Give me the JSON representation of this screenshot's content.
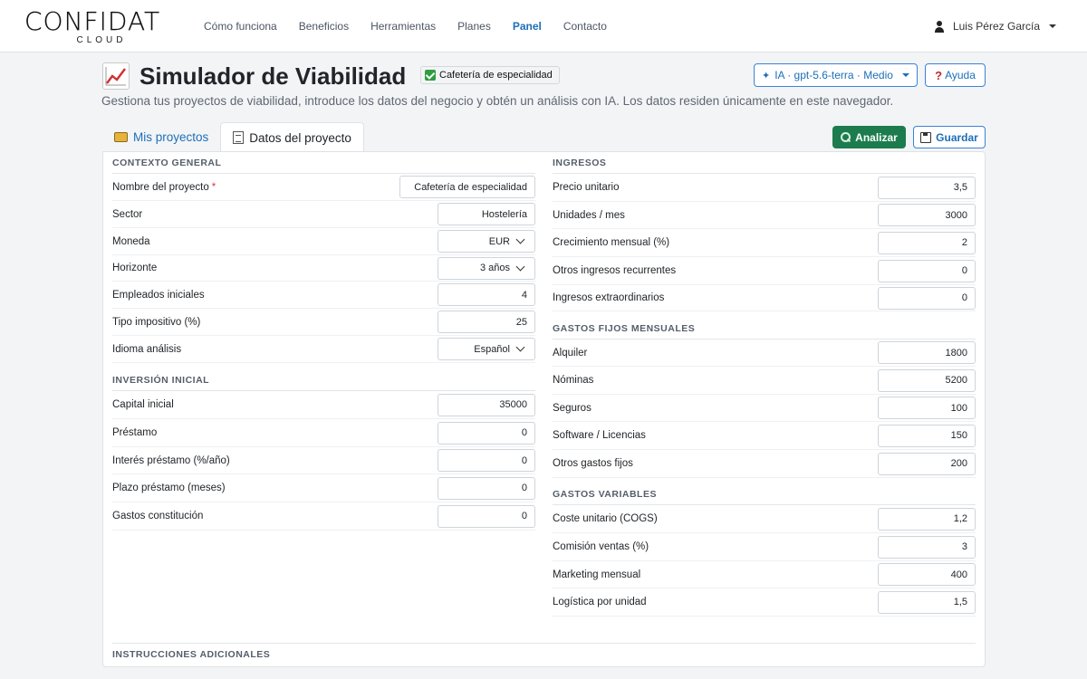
{
  "brand": {
    "name": "CONFIDAT",
    "sub": "CLOUD"
  },
  "nav": {
    "items": [
      "Cómo funciona",
      "Beneficios",
      "Herramientas",
      "Planes",
      "Panel",
      "Contacto"
    ],
    "active": "Panel"
  },
  "user": {
    "name": "Luis Pérez García"
  },
  "header": {
    "title_icon": "chart-increasing-icon",
    "title": "Simulador de Viabilidad",
    "project_badge": "Cafetería de especialidad",
    "ai_label": "IA · gpt-5.6-terra · Medio",
    "help_label": "Ayuda",
    "subtitle": "Gestiona tus proyectos de viabilidad, introduce los datos del negocio y obtén un análisis con IA. Los datos residen únicamente en este navegador."
  },
  "tabs": [
    {
      "label": "Mis proyectos",
      "icon": "folder-icon"
    },
    {
      "label": "Datos del proyecto",
      "icon": "memo-icon",
      "active": true
    }
  ],
  "actions": {
    "analyze": "Analizar",
    "save": "Guardar"
  },
  "sections": {
    "contexto": "CONTEXTO GENERAL",
    "inversion": "INVERSIÓN INICIAL",
    "ingresos": "INGRESOS",
    "fijos": "GASTOS FIJOS MENSUALES",
    "variables": "GASTOS VARIABLES",
    "instrucciones": "INSTRUCCIONES ADICIONALES"
  },
  "contexto": {
    "nombre": {
      "label": "Nombre del proyecto",
      "required": "*",
      "value": "Cafetería de especialidad"
    },
    "sector": {
      "label": "Sector",
      "value": "Hostelería"
    },
    "moneda": {
      "label": "Moneda",
      "value": "EUR"
    },
    "horizonte": {
      "label": "Horizonte",
      "value": "3 años"
    },
    "empleados": {
      "label": "Empleados iniciales",
      "value": "4"
    },
    "impuesto": {
      "label": "Tipo impositivo (%)",
      "value": "25"
    },
    "idioma": {
      "label": "Idioma análisis",
      "value": "Español"
    }
  },
  "inversion": {
    "capital": {
      "label": "Capital inicial",
      "value": "35000"
    },
    "prestamo": {
      "label": "Préstamo",
      "value": "0"
    },
    "interes": {
      "label": "Interés préstamo (%/año)",
      "value": "0"
    },
    "plazo": {
      "label": "Plazo préstamo (meses)",
      "value": "0"
    },
    "constitucion": {
      "label": "Gastos constitución",
      "value": "0"
    }
  },
  "ingresos": {
    "precio": {
      "label": "Precio unitario",
      "value": "3,5"
    },
    "unidades": {
      "label": "Unidades / mes",
      "value": "3000"
    },
    "crecimiento": {
      "label": "Crecimiento mensual (%)",
      "value": "2"
    },
    "recurrentes": {
      "label": "Otros ingresos recurrentes",
      "value": "0"
    },
    "extraordinarios": {
      "label": "Ingresos extraordinarios",
      "value": "0"
    }
  },
  "fijos": {
    "alquiler": {
      "label": "Alquiler",
      "value": "1800"
    },
    "nominas": {
      "label": "Nóminas",
      "value": "5200"
    },
    "seguros": {
      "label": "Seguros",
      "value": "100"
    },
    "software": {
      "label": "Software / Licencias",
      "value": "150"
    },
    "otros": {
      "label": "Otros gastos fijos",
      "value": "200"
    }
  },
  "variables": {
    "coste": {
      "label": "Coste unitario (COGS)",
      "value": "1,2"
    },
    "comision": {
      "label": "Comisión ventas (%)",
      "value": "3"
    },
    "marketing": {
      "label": "Marketing mensual",
      "value": "400"
    },
    "logistica": {
      "label": "Logística por unidad",
      "value": "1,5"
    }
  }
}
